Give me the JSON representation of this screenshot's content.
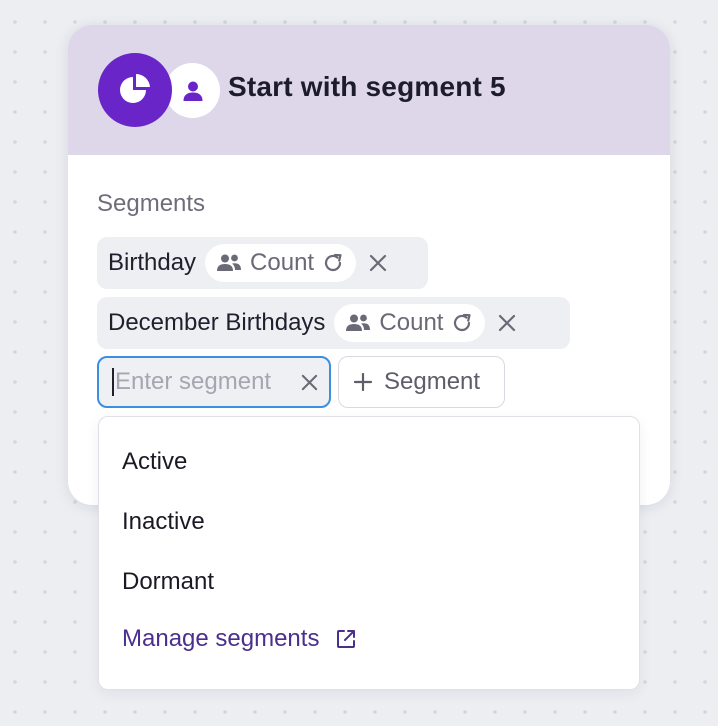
{
  "card": {
    "title": "Start with segment 5",
    "section_label": "Segments",
    "accent_color": "#6a25c9",
    "header_color": "#ddd7e9"
  },
  "chips": [
    {
      "name": "Birthday",
      "count_label": "Count"
    },
    {
      "name": "December Birthdays",
      "count_label": "Count"
    }
  ],
  "segment_input": {
    "value": "",
    "placeholder": "Enter segment"
  },
  "add_button": {
    "label": "Segment"
  },
  "dropdown": {
    "options": [
      "Active",
      "Inactive",
      "Dormant"
    ],
    "manage_label": "Manage segments",
    "link_color": "#4b2f8f"
  },
  "icons": {
    "segment": "pie-chart-icon",
    "person": "person-icon",
    "count": "people-icon",
    "refresh": "refresh-icon",
    "remove": "close-icon",
    "add": "plus-icon",
    "external": "external-link-icon"
  }
}
